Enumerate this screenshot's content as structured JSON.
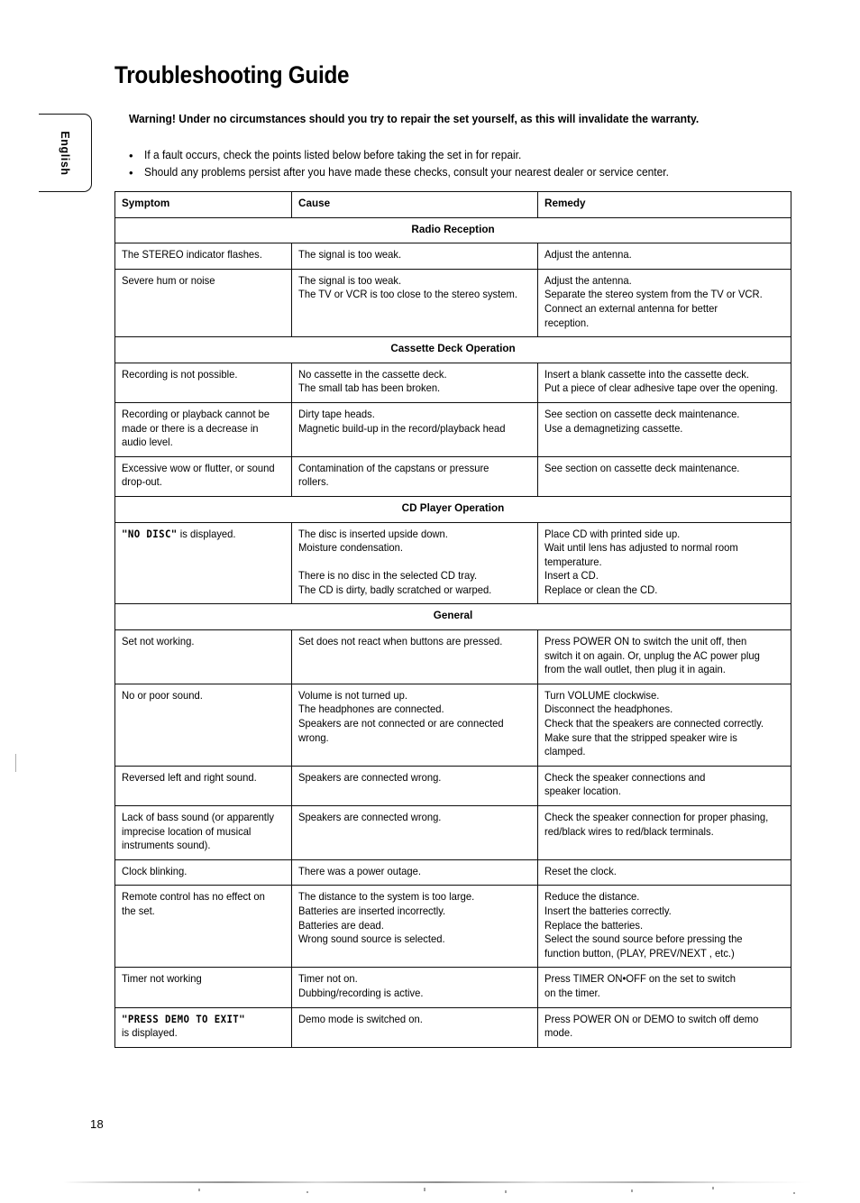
{
  "document": {
    "title": "Troubleshooting Guide",
    "language_tab": "English",
    "page_number": "18",
    "warning": "Warning!  Under no circumstances should you try to repair the set yourself, as this will invalidate the warranty.",
    "bullet_marker": "•",
    "bullets": [
      "If a fault occurs, check the points listed below before taking the set in for repair.",
      "Should any problems persist after you have made these checks, consult your nearest dealer or service center."
    ]
  },
  "table": {
    "headers": [
      "Symptom",
      "Cause",
      "Remedy"
    ],
    "sections": [
      {
        "section_title": "Radio Reception",
        "rows": [
          {
            "symptom": [
              "The STEREO indicator flashes."
            ],
            "cause": [
              "The signal is too weak."
            ],
            "remedy": [
              "Adjust the antenna."
            ]
          },
          {
            "symptom": [
              "Severe hum or noise"
            ],
            "cause": [
              "The signal is too weak.",
              "The TV or VCR is too close to the stereo system."
            ],
            "remedy": [
              "Adjust the antenna.",
              "Separate the stereo system from the TV or VCR.",
              "Connect an external antenna for better",
              "reception."
            ]
          }
        ]
      },
      {
        "section_title": "Cassette Deck Operation",
        "rows": [
          {
            "symptom": [
              "Recording is not possible."
            ],
            "cause": [
              "No cassette in the cassette deck.",
              "The small tab has been broken."
            ],
            "remedy": [
              "Insert a blank cassette into the cassette deck.",
              "Put a piece of clear adhesive tape over the opening."
            ]
          },
          {
            "symptom": [
              "Recording or playback cannot be",
              "made or there is a decrease in",
              "audio level."
            ],
            "cause": [
              "Dirty tape heads.",
              "Magnetic build-up in the record/playback head"
            ],
            "remedy": [
              "See section on cassette deck maintenance.",
              "Use a demagnetizing cassette."
            ]
          },
          {
            "symptom": [
              "Excessive wow or flutter, or sound",
              "drop-out."
            ],
            "cause": [
              "Contamination of the capstans or pressure",
              "rollers."
            ],
            "remedy": [
              "See section on cassette deck maintenance."
            ]
          }
        ]
      },
      {
        "section_title": "CD Player Operation",
        "rows": [
          {
            "symptom_lcd": "\"NO  DISC\"",
            "symptom_tail": " is displayed.",
            "cause": [
              "The disc is inserted upside down.",
              "Moisture condensation.",
              "",
              "There is no disc in the selected CD tray.",
              "The CD is dirty, badly scratched or warped."
            ],
            "remedy": [
              "Place CD with printed side up.",
              "Wait until lens has adjusted to normal room",
              "temperature.",
              "Insert a CD.",
              "Replace or clean the CD."
            ]
          }
        ]
      },
      {
        "section_title": "General",
        "rows": [
          {
            "symptom": [
              "Set not working."
            ],
            "cause": [
              "Set does not react when buttons are pressed."
            ],
            "remedy": [
              "Press POWER ON to switch the unit off, then",
              "switch it on again. Or, unplug the AC power plug",
              "from the wall outlet, then plug it in again."
            ]
          },
          {
            "symptom": [
              "No or poor sound."
            ],
            "cause": [
              "Volume is not turned up.",
              "The headphones are connected.",
              "Speakers are not connected or are connected",
              "wrong."
            ],
            "remedy": [
              "Turn VOLUME clockwise.",
              "Disconnect the headphones.",
              "Check that the speakers are connected correctly.",
              "Make sure that the stripped speaker wire is",
              "clamped."
            ]
          },
          {
            "symptom": [
              "Reversed left and right sound."
            ],
            "cause": [
              "Speakers are connected wrong."
            ],
            "remedy": [
              "Check the speaker connections and",
              "speaker location."
            ]
          },
          {
            "symptom": [
              "Lack of bass sound (or apparently",
              "imprecise location of musical",
              "instruments sound)."
            ],
            "cause": [
              "Speakers are connected wrong."
            ],
            "remedy": [
              "Check the speaker connection for proper phasing,",
              "red/black wires to red/black terminals."
            ]
          },
          {
            "symptom": [
              "Clock blinking."
            ],
            "cause": [
              "There was a power outage."
            ],
            "remedy": [
              "Reset the clock."
            ]
          },
          {
            "symptom": [
              "Remote control has no effect on",
              "the set."
            ],
            "cause": [
              "The distance to the system is too large.",
              "Batteries are inserted incorrectly.",
              "Batteries are dead.",
              "Wrong sound source is selected."
            ],
            "remedy": [
              "Reduce the distance.",
              "Insert the batteries correctly.",
              "Replace the batteries.",
              "Select the sound source before pressing the",
              "function button, (PLAY, PREV/NEXT , etc.)"
            ]
          },
          {
            "symptom": [
              "Timer not working"
            ],
            "cause": [
              "Timer not on.",
              "Dubbing/recording is active."
            ],
            "remedy": [
              "Press TIMER ON•OFF on the set to switch",
              "on the timer."
            ]
          },
          {
            "symptom_lcd": "\"PRESS DEMO TO EXIT\"",
            "symptom_lines_after": [
              "is displayed."
            ],
            "cause": [
              "Demo mode is switched on."
            ],
            "remedy": [
              "Press POWER ON or DEMO to switch off demo",
              "mode."
            ]
          }
        ]
      }
    ]
  }
}
